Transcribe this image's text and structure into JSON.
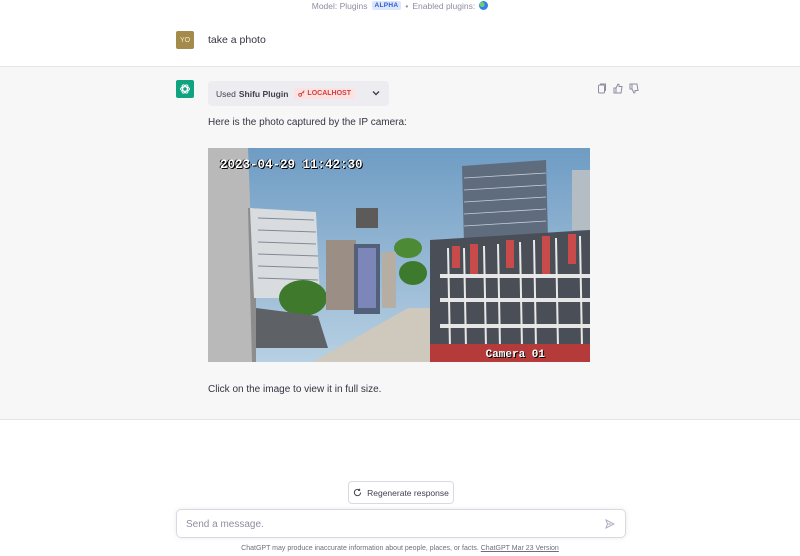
{
  "topbar": {
    "model_text": "Model: Plugins",
    "alpha_badge": "ALPHA",
    "separator": "•",
    "enabled_plugins_text": "Enabled plugins:",
    "plugin_icon": "globe-icon"
  },
  "user_message": {
    "avatar_initials": "YO",
    "text": "take a photo"
  },
  "assistant_message": {
    "plugin_prefix": "Used",
    "plugin_name": "Shifu Plugin",
    "plugin_badge": "LOCALHOST",
    "text_intro": "Here is the photo captured by the IP camera:",
    "text_outro": "Click on the image to view it in full size.",
    "photo": {
      "timestamp": "2023-04-29 11:42:30",
      "camera_label": "Camera 01"
    },
    "actions": [
      "copy-icon",
      "thumbs-up-icon",
      "thumbs-down-icon"
    ]
  },
  "regenerate_button": {
    "label": "Regenerate response",
    "icon": "refresh-icon"
  },
  "composer": {
    "placeholder": "Send a message.",
    "send_icon": "send-icon"
  },
  "footer": {
    "text": "ChatGPT may produce inaccurate information about people, places, or facts.",
    "link_text": "ChatGPT Mar 23 Version"
  },
  "colors": {
    "accent_green": "#10a37f",
    "assistant_bg": "#f7f7f8",
    "localhost_red": "#d33d3d",
    "alpha_blue": "#3158c7"
  }
}
